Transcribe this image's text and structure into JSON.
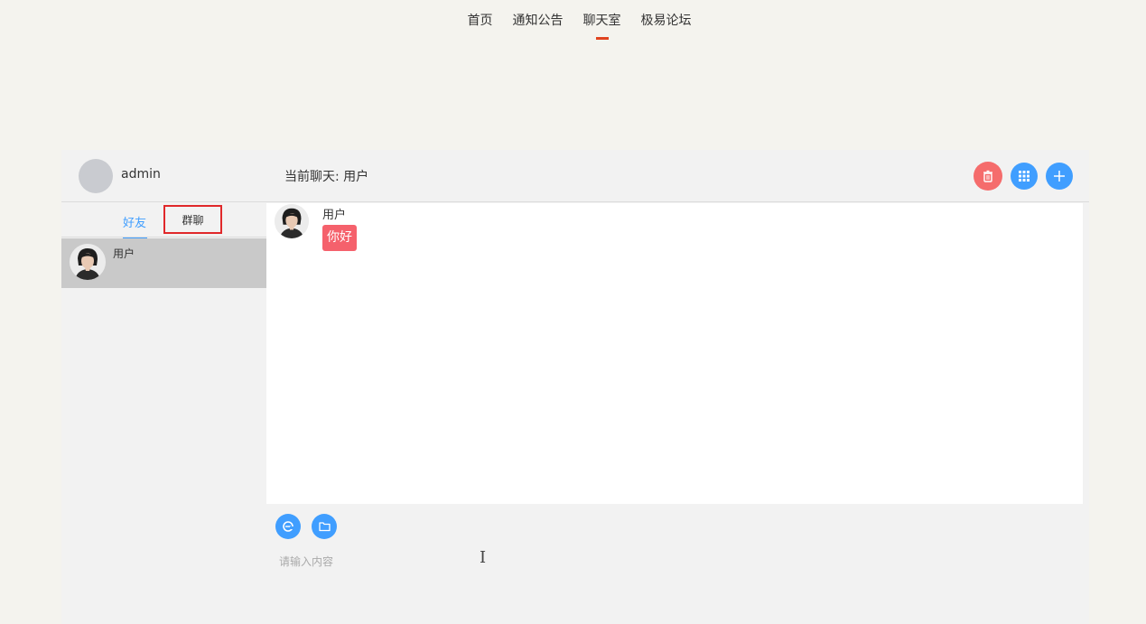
{
  "topnav": {
    "items": [
      {
        "label": "首页"
      },
      {
        "label": "通知公告"
      },
      {
        "label": "聊天室",
        "active": true
      },
      {
        "label": "极易论坛"
      }
    ],
    "active_color": "#e0431f"
  },
  "chat": {
    "me": {
      "name": "admin"
    },
    "current_chat_label": "当前聊天: 用户",
    "header_buttons": [
      {
        "icon": "trash-icon",
        "color": "#f56c6c"
      },
      {
        "icon": "grid-icon",
        "color": "#409eff"
      },
      {
        "icon": "plus-icon",
        "color": "#409eff"
      }
    ],
    "tabs": {
      "friends": "好友",
      "groups": "群聊"
    },
    "contacts": [
      {
        "name": "用户",
        "selected": true
      }
    ],
    "messages": [
      {
        "sender": "用户",
        "text": "你好",
        "bubble_color": "#f5616c"
      }
    ],
    "input": {
      "placeholder": "请输入内容",
      "value": ""
    },
    "toolbar": [
      {
        "icon": "emoji-icon"
      },
      {
        "icon": "folder-icon"
      }
    ]
  }
}
